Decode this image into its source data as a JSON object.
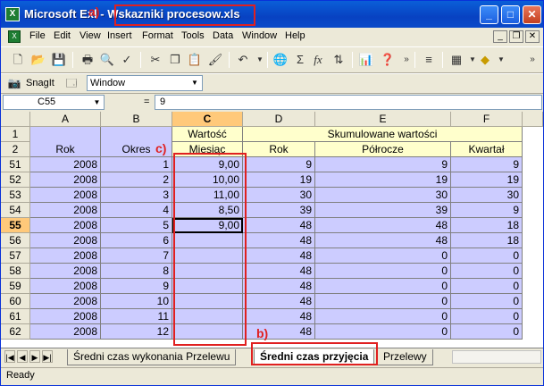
{
  "window": {
    "title_prefix": "Microsoft Ex",
    "title_sep": "l -",
    "file_name": "Wskazniki procesow.xls"
  },
  "menu": [
    "File",
    "Edit",
    "View",
    "Insert",
    "Format",
    "Tools",
    "Data",
    "Window",
    "Help"
  ],
  "mdi_buttons": [
    "_",
    "❐",
    "✕"
  ],
  "snagit": {
    "label": "SnagIt",
    "select_value": "Window"
  },
  "formula_bar": {
    "name_box": "C55",
    "eq": "=",
    "value": "9"
  },
  "columns": [
    "A",
    "B",
    "C",
    "D",
    "E",
    "F"
  ],
  "header_rows": {
    "r1": {
      "num": "1",
      "c": "Wartość",
      "merged": "Skumulowane wartości"
    },
    "r2": {
      "num": "2",
      "a": "Rok",
      "b": "Okres",
      "c": "Miesiąc",
      "d": "Rok",
      "e": "Półrocze",
      "f": "Kwartał"
    }
  },
  "rows": [
    {
      "num": "51",
      "a": "2008",
      "b": "1",
      "c": "9,00",
      "d": "9",
      "e": "9",
      "f": "9"
    },
    {
      "num": "52",
      "a": "2008",
      "b": "2",
      "c": "10,00",
      "d": "19",
      "e": "19",
      "f": "19"
    },
    {
      "num": "53",
      "a": "2008",
      "b": "3",
      "c": "11,00",
      "d": "30",
      "e": "30",
      "f": "30"
    },
    {
      "num": "54",
      "a": "2008",
      "b": "4",
      "c": "8,50",
      "d": "39",
      "e": "39",
      "f": "9"
    },
    {
      "num": "55",
      "a": "2008",
      "b": "5",
      "c": "9,00",
      "d": "48",
      "e": "48",
      "f": "18"
    },
    {
      "num": "56",
      "a": "2008",
      "b": "6",
      "c": "",
      "d": "48",
      "e": "48",
      "f": "18"
    },
    {
      "num": "57",
      "a": "2008",
      "b": "7",
      "c": "",
      "d": "48",
      "e": "0",
      "f": "0"
    },
    {
      "num": "58",
      "a": "2008",
      "b": "8",
      "c": "",
      "d": "48",
      "e": "0",
      "f": "0"
    },
    {
      "num": "59",
      "a": "2008",
      "b": "9",
      "c": "",
      "d": "48",
      "e": "0",
      "f": "0"
    },
    {
      "num": "60",
      "a": "2008",
      "b": "10",
      "c": "",
      "d": "48",
      "e": "0",
      "f": "0"
    },
    {
      "num": "61",
      "a": "2008",
      "b": "11",
      "c": "",
      "d": "48",
      "e": "0",
      "f": "0"
    },
    {
      "num": "62",
      "a": "2008",
      "b": "12",
      "c": "",
      "d": "48",
      "e": "0",
      "f": "0"
    }
  ],
  "sheet_tabs": [
    {
      "label": "Średni czas wykonania Przelewu",
      "active": false
    },
    {
      "label": "Średni czas przyjęcia",
      "active": true
    },
    {
      "label": "Przelewy",
      "active": false
    }
  ],
  "status": "Ready",
  "annotations": {
    "a": "a)",
    "b": "b)",
    "c": "c)"
  },
  "colors": {
    "accent": "#0a5fd8",
    "cell_fill": "#ccccff",
    "annotation": "#e02020",
    "selected_header": "#ffc97a"
  }
}
